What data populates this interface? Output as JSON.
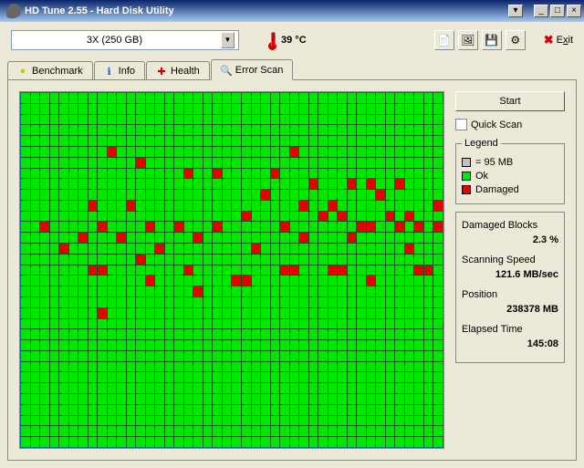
{
  "window": {
    "title": "HD Tune 2.55 - Hard Disk Utility"
  },
  "toolbar": {
    "drive": "3X (250 GB)",
    "temp": "39 °C",
    "exit_label": "Exit",
    "exit_u": "x"
  },
  "tabs": {
    "benchmark": "Benchmark",
    "info": "Info",
    "health": "Health",
    "errorscan": "Error Scan"
  },
  "controls": {
    "start": "Start",
    "quick_scan": "Quick Scan"
  },
  "legend": {
    "title": "Legend",
    "block_size": "= 95 MB",
    "ok": "Ok",
    "damaged": "Damaged"
  },
  "stats": {
    "damaged_label": "Damaged Blocks",
    "damaged_val": "2.3 %",
    "speed_label": "Scanning Speed",
    "speed_val": "121.6 MB/sec",
    "pos_label": "Position",
    "pos_val": "238378 MB",
    "time_label": "Elapsed Time",
    "time_val": "145:08"
  },
  "grid": {
    "cols": 44,
    "rows": 33,
    "damaged": [
      [
        5,
        9
      ],
      [
        5,
        28
      ],
      [
        6,
        12
      ],
      [
        7,
        17
      ],
      [
        7,
        20
      ],
      [
        7,
        26
      ],
      [
        8,
        30
      ],
      [
        8,
        34
      ],
      [
        8,
        36
      ],
      [
        8,
        39
      ],
      [
        9,
        25
      ],
      [
        9,
        37
      ],
      [
        10,
        7
      ],
      [
        10,
        11
      ],
      [
        10,
        29
      ],
      [
        10,
        32
      ],
      [
        10,
        43
      ],
      [
        11,
        23
      ],
      [
        11,
        31
      ],
      [
        11,
        33
      ],
      [
        11,
        38
      ],
      [
        11,
        40
      ],
      [
        12,
        2
      ],
      [
        12,
        8
      ],
      [
        12,
        13
      ],
      [
        12,
        16
      ],
      [
        12,
        20
      ],
      [
        12,
        27
      ],
      [
        12,
        35
      ],
      [
        12,
        36
      ],
      [
        12,
        39
      ],
      [
        12,
        41
      ],
      [
        12,
        43
      ],
      [
        13,
        6
      ],
      [
        13,
        10
      ],
      [
        13,
        18
      ],
      [
        13,
        29
      ],
      [
        13,
        34
      ],
      [
        14,
        4
      ],
      [
        14,
        14
      ],
      [
        14,
        24
      ],
      [
        14,
        40
      ],
      [
        15,
        12
      ],
      [
        16,
        7
      ],
      [
        16,
        8
      ],
      [
        16,
        17
      ],
      [
        16,
        27
      ],
      [
        16,
        28
      ],
      [
        16,
        32
      ],
      [
        16,
        33
      ],
      [
        16,
        41
      ],
      [
        16,
        42
      ],
      [
        17,
        13
      ],
      [
        17,
        22
      ],
      [
        17,
        23
      ],
      [
        17,
        36
      ],
      [
        18,
        18
      ],
      [
        20,
        8
      ]
    ]
  }
}
